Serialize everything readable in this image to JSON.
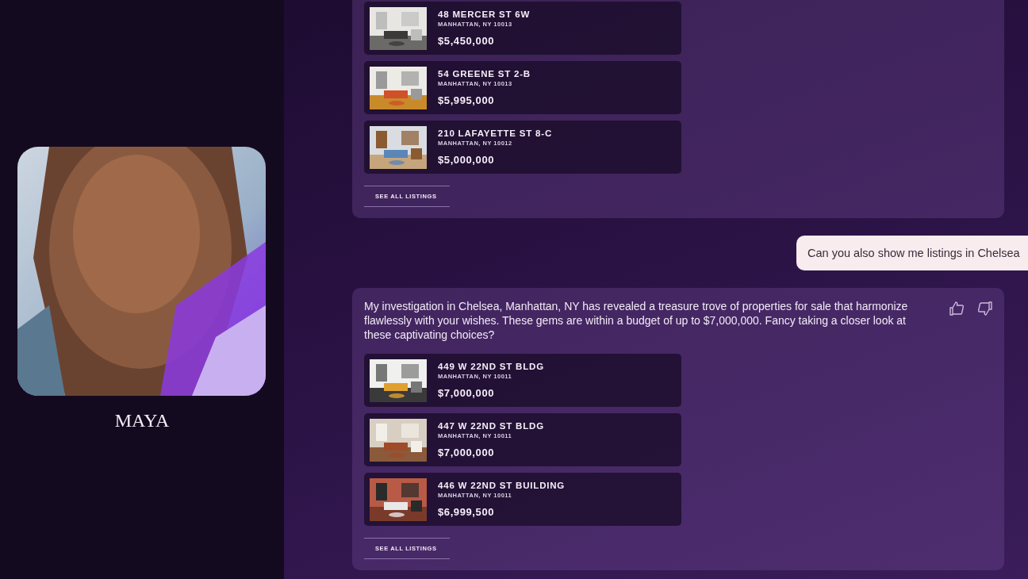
{
  "assistant": {
    "name": "MAYA"
  },
  "messages": [
    {
      "kind": "assistant",
      "listings": [
        {
          "address": "48 MERCER ST 6W",
          "city": "MANHATTAN, NY 10013",
          "price": "$5,450,000"
        },
        {
          "address": "54 GREENE ST 2-B",
          "city": "MANHATTAN, NY 10013",
          "price": "$5,995,000"
        },
        {
          "address": "210 LAFAYETTE ST 8-C",
          "city": "MANHATTAN, NY 10012",
          "price": "$5,000,000"
        }
      ],
      "link": "SEE ALL LISTINGS"
    },
    {
      "kind": "user",
      "text": "Can you also show me listings in Chelsea"
    },
    {
      "kind": "assistant",
      "text": "My investigation in Chelsea, Manhattan, NY has revealed a treasure trove of properties for sale that harmonize flawlessly with your wishes. These gems are within a budget of up to $7,000,000. Fancy taking a closer look at these captivating choices?",
      "listings": [
        {
          "address": "449 W 22ND ST BLDG",
          "city": "MANHATTAN, NY 10011",
          "price": "$7,000,000"
        },
        {
          "address": "447 W 22ND ST BLDG",
          "city": "MANHATTAN, NY 10011",
          "price": "$7,000,000"
        },
        {
          "address": "446 W 22ND ST BUILDING",
          "city": "MANHATTAN, NY 10011",
          "price": "$6,999,500"
        }
      ],
      "link": "SEE ALL LISTINGS"
    }
  ]
}
